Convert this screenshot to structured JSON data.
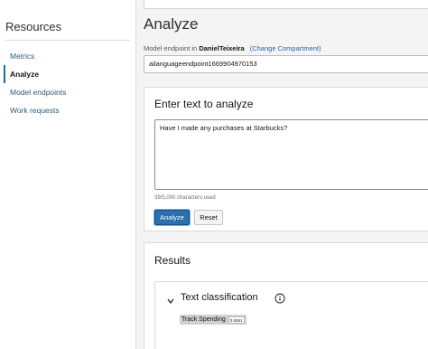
{
  "sidebar": {
    "title": "Resources",
    "items": [
      {
        "label": "Metrics",
        "active": false
      },
      {
        "label": "Analyze",
        "active": true
      },
      {
        "label": "Model endpoints",
        "active": false
      },
      {
        "label": "Work requests",
        "active": false
      }
    ]
  },
  "main": {
    "title": "Analyze",
    "endpoint_prefix": "Model endpoint in",
    "compartment": "DanielTeixeira",
    "change_compartment": "(Change Compartment)",
    "endpoint_value": "ailanguageendpoint1669904970153"
  },
  "text_panel": {
    "title": "Enter text to analyze",
    "input_value": "Have I made any purchases at Starbucks?",
    "char_count": "39/5,000 characters used",
    "analyze_label": "Analyze",
    "reset_label": "Reset"
  },
  "results": {
    "title": "Results",
    "section_title": "Text classification",
    "tag_label": "Track Spending",
    "tag_score": "0.9361"
  },
  "colors": {
    "primary": "#2c6fae",
    "link": "#2363b6",
    "active_indicator": "#1f6f8b"
  }
}
